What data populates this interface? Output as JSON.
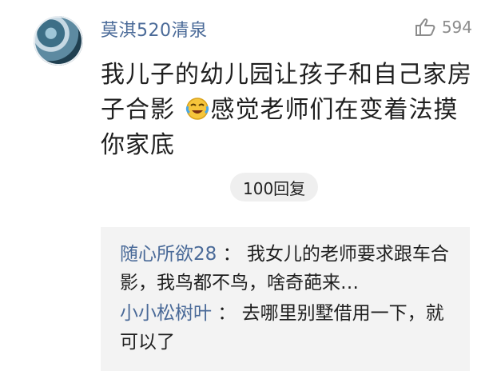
{
  "comment": {
    "username": "莫淇520清泉",
    "likes": "594",
    "text_part1": "我儿子的幼儿园让孩子和自己家房子合影",
    "text_part2": "感觉老师们在变着法摸你家底",
    "emoji": "laughing-crying-emoji",
    "reply_count_label": "100回复"
  },
  "replies": [
    {
      "name": "随心所欲28",
      "separator": "：",
      "text": "我女儿的老师要求跟车合影，我鸟都不鸟，啥奇葩来…"
    },
    {
      "name": "小小松树叶",
      "separator": "：",
      "text": "去哪里别墅借用一下，就可以了"
    }
  ],
  "colors": {
    "name": "#4a6a98",
    "muted": "#8c8c8c",
    "reply_bg": "#f3f3f3",
    "pill_bg": "#efefef"
  }
}
